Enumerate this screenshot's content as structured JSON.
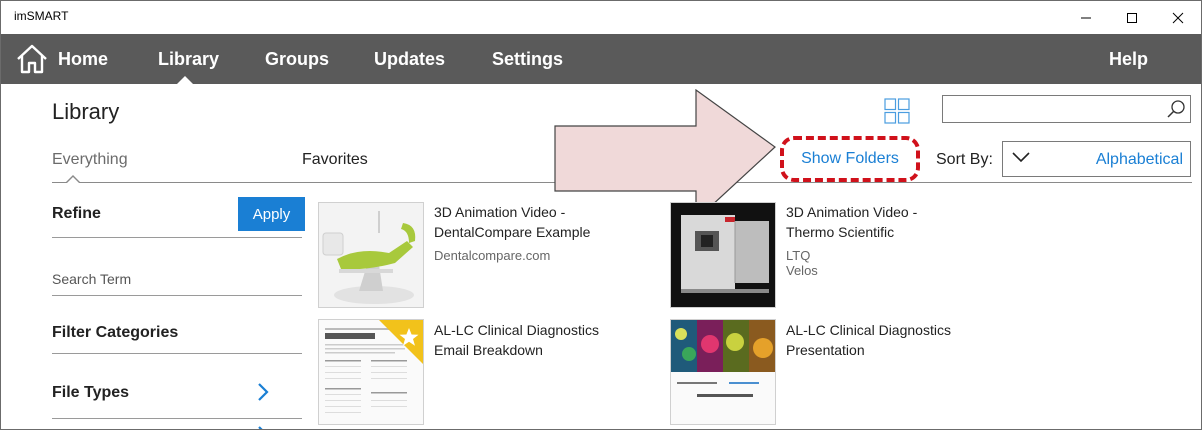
{
  "window": {
    "title": "imSMART"
  },
  "nav": {
    "items": [
      {
        "label": "Home"
      },
      {
        "label": "Library"
      },
      {
        "label": "Groups"
      },
      {
        "label": "Updates"
      },
      {
        "label": "Settings"
      }
    ],
    "help": "Help",
    "active": "Library"
  },
  "page": {
    "title": "Library"
  },
  "search": {
    "value": "",
    "placeholder": ""
  },
  "tabs": [
    {
      "label": "Everything"
    },
    {
      "label": "Favorites"
    }
  ],
  "toolbar": {
    "show_folders": "Show Folders",
    "sort_label": "Sort By:",
    "sort_value": "Alphabetical"
  },
  "sidebar": {
    "refine": "Refine",
    "apply": "Apply",
    "search_term": "Search Term",
    "filter_categories": "Filter Categories",
    "file_types": "File Types"
  },
  "items": [
    {
      "title_line1": "3D Animation Video -",
      "title_line2": "DentalCompare Example",
      "subtitle": "Dentalcompare.com",
      "thumb": "dental-chair",
      "favorite": false
    },
    {
      "title_line1": "3D Animation Video -",
      "title_line2": "Thermo Scientific",
      "subtitle": "LTQ Velos",
      "thumb": "lab-instrument",
      "favorite": false
    },
    {
      "title_line1": "AL-LC Clinical Diagnostics",
      "title_line2": "Email Breakdown",
      "subtitle": "",
      "thumb": "email-document",
      "favorite": true
    },
    {
      "title_line1": "AL-LC Clinical Diagnostics",
      "title_line2": "Presentation",
      "subtitle": "",
      "thumb": "presentation-slide",
      "favorite": false
    }
  ],
  "colors": {
    "accent": "#1a7fd4",
    "navbar": "#5a5a5a",
    "annotation": "#d0111b",
    "favorite_star": "#f2c21b"
  }
}
